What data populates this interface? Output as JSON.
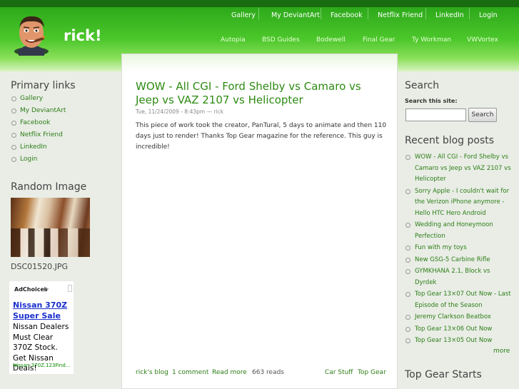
{
  "site": {
    "name": "rick!",
    "logo": "cigar-man-avatar"
  },
  "primary_nav": [
    {
      "label": "Gallery"
    },
    {
      "label": "My DeviantArt"
    },
    {
      "label": "Facebook"
    },
    {
      "label": "Netflix Friend"
    },
    {
      "label": "LinkedIn"
    },
    {
      "label": "Login"
    }
  ],
  "secondary_nav": [
    {
      "label": "Autopia"
    },
    {
      "label": "BSD Guides"
    },
    {
      "label": "Bodewell"
    },
    {
      "label": "Final Gear"
    },
    {
      "label": "Ty Workman"
    },
    {
      "label": "VWVortex"
    }
  ],
  "left": {
    "primary_title": "Primary links",
    "primary_links": [
      {
        "label": "Gallery"
      },
      {
        "label": "My DeviantArt"
      },
      {
        "label": "Facebook"
      },
      {
        "label": "Netflix Friend"
      },
      {
        "label": "LinkedIn"
      },
      {
        "label": "Login"
      }
    ],
    "random_title": "Random Image",
    "random_image_name": "DSC01520.JPG",
    "ad": {
      "choices": "AdChoices",
      "title": "Nissan 370Z Super Sale",
      "body": "Nissan Dealers Must Clear 370Z Stock. Get Nissan Deals!",
      "url": "Nissan-370Z.123Find..."
    }
  },
  "node": {
    "title": "WOW - All CGI - Ford Shelby vs Camaro vs Jeep vs VAZ 2107 vs Helicopter",
    "meta": "Tue, 11/24/2009 - 8:43pm — rick",
    "body": "This piece of work took the creator, PanTural, 5 days to animate and then 110 days just to render! Thanks Top Gear magazine for the reference. This guy is incredible!",
    "links": {
      "blog": "rick's blog",
      "comments": "1 comment",
      "read_more": "Read more",
      "reads": "663 reads",
      "tag1": "Car Stuff",
      "tag2": "Top Gear"
    }
  },
  "right": {
    "search_title": "Search",
    "search_label": "Search this site:",
    "search_value": "",
    "search_button": "Search",
    "recent_title": "Recent blog posts",
    "recent_posts": [
      {
        "label": "WOW - All CGI - Ford Shelby vs Camaro vs Jeep vs VAZ 2107 vs Helicopter"
      },
      {
        "label": "Sorry Apple - I couldn't wait for the Verizon iPhone anymore - Hello HTC Hero Android"
      },
      {
        "label": "Wedding and Honeymoon Perfection"
      },
      {
        "label": "Fun with my toys"
      },
      {
        "label": "New GSG-5 Carbine Rifle"
      },
      {
        "label": "GYMKHANA 2.1, Block vs Dyrdek"
      },
      {
        "label": "Top Gear 13×07 Out Now - Last Episode of the Season"
      },
      {
        "label": "Jeremy Clarkson Beatbox"
      },
      {
        "label": "Top Gear 13×06 Out Now"
      },
      {
        "label": "Top Gear 13×05 Out Now"
      }
    ],
    "more": "more",
    "topgear_title": "Top Gear Starts"
  },
  "colors": {
    "accent": "#2d8b12",
    "header_green": "#4cc72b",
    "link": "#2d7d16"
  }
}
